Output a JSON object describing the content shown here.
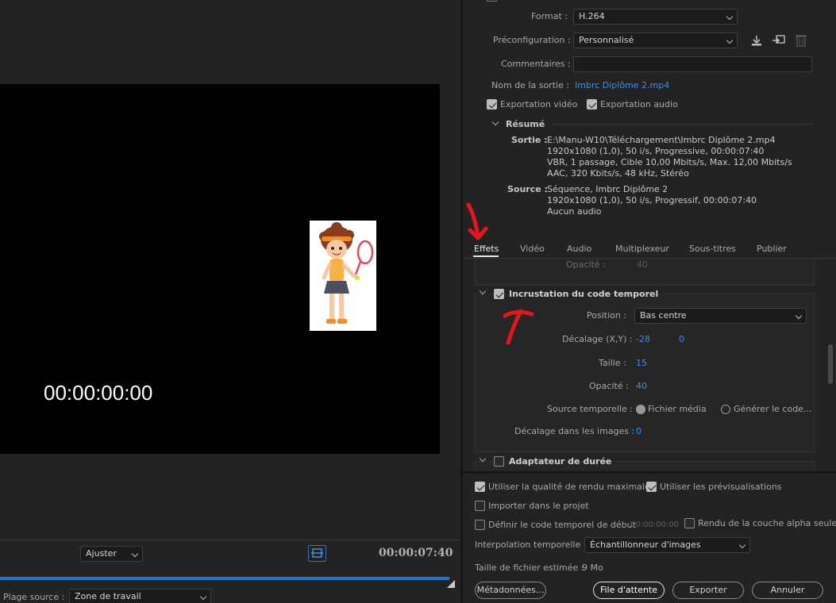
{
  "left": {
    "timecode": "00:00:00:00",
    "fit_dropdown": "Ajuster",
    "duration": "00:00:07:40",
    "source_range_label": "Plage source :",
    "source_range_value": "Zone de travail"
  },
  "export": {
    "format_label": "Format :",
    "format_value": "H.264",
    "preset_label": "Préconfiguration :",
    "preset_value": "Personnalisé",
    "comments_label": "Commentaires :",
    "comments_value": "",
    "output_label": "Nom de la sortie :",
    "output_value": "Imbrc Diplôme 2.mp4",
    "export_video": "Exportation vidéo",
    "export_audio": "Exportation audio",
    "summary_title": "Résumé",
    "output_key": "Sortie :",
    "output_lines": [
      "E:\\Manu-W10\\Téléchargement\\Imbrc Diplôme 2.mp4",
      "1920x1080 (1,0), 50 i/s, Progressive, 00:00:07:40",
      "VBR, 1 passage, Cible 10,00  Mbits/s, Max. 12,00  Mbits/s",
      "AAC, 320  Kbits/s, 48  kHz, Stéréo"
    ],
    "source_key": "Source :",
    "source_lines": [
      "Séquence, Imbrc Diplôme 2",
      "1920x1080 (1,0), 50  i/s, Progressif, 00:00:07:40",
      "Aucun audio"
    ]
  },
  "tabs": [
    {
      "label": "Effets"
    },
    {
      "label": "Vidéo"
    },
    {
      "label": "Audio"
    },
    {
      "label": "Multiplexeur"
    },
    {
      "label": "Sous-titres"
    },
    {
      "label": "Publier"
    }
  ],
  "effects": {
    "prev_opacity_label": "Opacité :",
    "prev_opacity_value": "40",
    "timecode_section": "Incrustation du code temporel",
    "position_label": "Position :",
    "position_value": "Bas centre",
    "offset_label": "Décalage (X,Y) :",
    "offset_x": "-28",
    "offset_y": "0",
    "size_label": "Taille :",
    "size_value": "15",
    "opacity_label": "Opacité :",
    "opacity_value": "40",
    "time_source_label": "Source temporelle :",
    "media_file": "Fichier média",
    "generate_code": "Générer le code...",
    "frame_offset_label": "Décalage dans les images :",
    "frame_offset_value": "0",
    "duration_adapter": "Adaptateur de durée"
  },
  "bottom": {
    "max_quality": "Utiliser la qualité de rendu maximale",
    "use_previews": "Utiliser les prévisualisations",
    "import_project": "Importer dans le projet",
    "set_start_tc": "Définir le code temporel de début",
    "start_tc_value": "00:00:00:00",
    "alpha_only": "Rendu de la couche alpha seule",
    "interp_label": "Interpolation temporelle :",
    "interp_value": "Échantillonneur d'images",
    "filesize_label": "Taille de fichier estimée :",
    "filesize_value": "9 Mo",
    "metadata_btn": "Métadonnées...",
    "queue_btn": "File d'attente",
    "export_btn": "Exporter",
    "cancel_btn": "Annuler"
  },
  "colors": {
    "accent": "#3d8ee6",
    "annotation": "#e3171b",
    "progress": "#1f77c9"
  }
}
